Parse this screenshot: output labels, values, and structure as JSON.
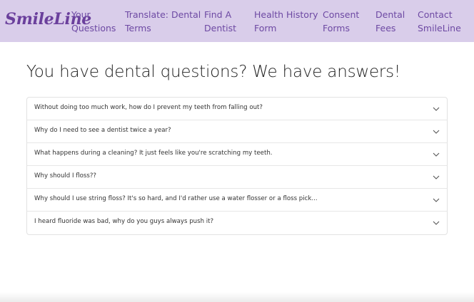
{
  "brand": "SmileLine",
  "nav": [
    {
      "line1": "Your",
      "line2": "Questions"
    },
    {
      "line1": "Translate: Dental",
      "line2": "Terms"
    },
    {
      "line1": "Find A",
      "line2": "Dentist"
    },
    {
      "line1": "Health History",
      "line2": "Form"
    },
    {
      "line1": "Consent",
      "line2": "Forms"
    },
    {
      "line1": "Dental",
      "line2": "Fees"
    },
    {
      "line1": "Contact",
      "line2": "SmileLine"
    }
  ],
  "page_title": "You have dental questions? We have answers!",
  "faq": [
    {
      "question": "Without doing too much work, how do I prevent my teeth from falling out?"
    },
    {
      "question": "Why do I need to see a dentist twice a year?"
    },
    {
      "question": "What happens during a cleaning? It just feels like you're scratching my teeth."
    },
    {
      "question": "Why should I floss??"
    },
    {
      "question": "Why should I use string floss? It's so hard, and I'd rather use a water flosser or a floss pick..."
    },
    {
      "question": "I heard fluoride was bad, why do you guys always push it?"
    }
  ],
  "colors": {
    "navbar": "#d9cdea",
    "brand": "#6a3f9c",
    "nav_link": "#6d49a3"
  },
  "icons": {
    "accordion_toggle": "chevron-down-icon"
  }
}
